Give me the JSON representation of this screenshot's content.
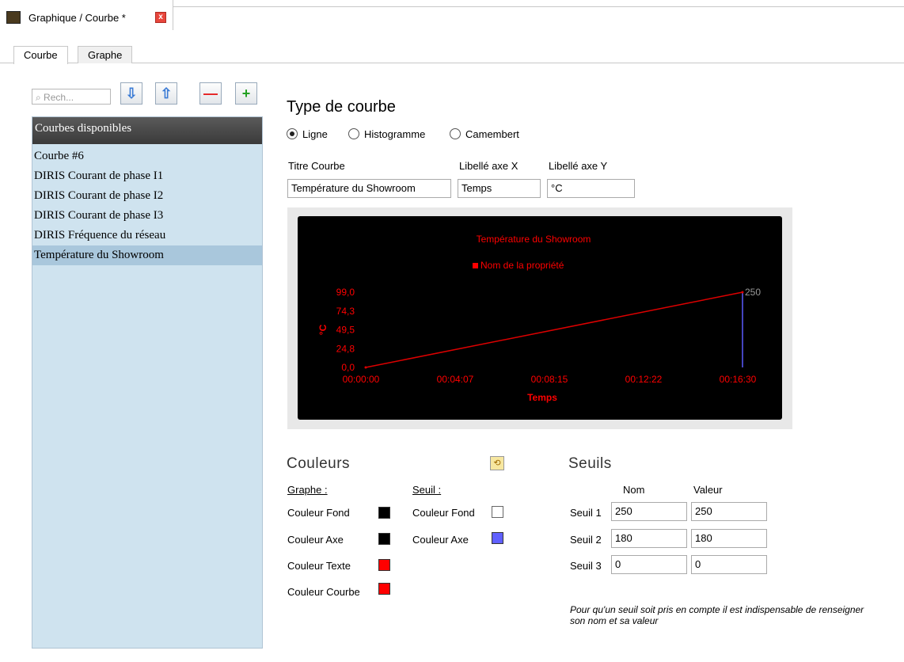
{
  "window": {
    "title": "Graphique / Courbe *",
    "close_glyph": "x"
  },
  "tabs": [
    {
      "label": "Courbe"
    },
    {
      "label": "Graphe"
    }
  ],
  "search": {
    "placeholder": "⌕ Rech..."
  },
  "toolbar": {
    "down_glyph": "⇩",
    "up_glyph": "⇧",
    "remove_glyph": "—",
    "add_glyph": "+"
  },
  "list": {
    "header": "Courbes disponibles",
    "items": [
      "Courbe #6",
      "DIRIS Courant de phase I1",
      "DIRIS Courant de phase I2",
      "DIRIS Courant de phase I3",
      "DIRIS Fréquence du réseau",
      "Température du Showroom"
    ],
    "selected_index": 5
  },
  "type_courbe": {
    "title": "Type de courbe",
    "options": [
      "Ligne",
      "Histogramme",
      "Camembert"
    ],
    "selected": "Ligne"
  },
  "fields": {
    "titre_label": "Titre Courbe",
    "titre_value": "Température du Showroom",
    "x_label": "Libellé axe X",
    "x_value": "Temps",
    "y_label": "Libellé axe Y",
    "y_value": "°C"
  },
  "chart_data": {
    "type": "line",
    "title": "Température du Showroom",
    "legend": "Nom de la propriété",
    "xlabel": "Temps",
    "ylabel": "°C",
    "x_ticks": [
      "00:00:00",
      "00:04:07",
      "00:08:15",
      "00:12:22",
      "00:16:30"
    ],
    "y_ticks": [
      "0,0",
      "24,8",
      "49,5",
      "74,3",
      "99,0"
    ],
    "ylim": [
      0,
      99
    ],
    "xlim_seconds": [
      0,
      990
    ],
    "series": [
      {
        "name": "Nom de la propriété",
        "x": [
          0,
          990
        ],
        "y": [
          0,
          99
        ]
      }
    ],
    "threshold": {
      "label": "250",
      "x": 990
    },
    "colors": {
      "background": "#000000",
      "text": "#ff0000",
      "curve": "#dd0000",
      "threshold": "#5a5aff",
      "threshold_label": "#999999"
    }
  },
  "couleurs": {
    "title": "Couleurs",
    "graphe_label": "Graphe :",
    "seuil_label": "Seuil :",
    "graphe": [
      {
        "label": "Couleur Fond",
        "color": "#000000"
      },
      {
        "label": "Couleur Axe",
        "color": "#000000"
      },
      {
        "label": "Couleur Texte",
        "color": "#ff0000"
      },
      {
        "label": "Couleur Courbe",
        "color": "#ff0000"
      }
    ],
    "seuil": [
      {
        "label": "Couleur Fond",
        "color": "#ffffff"
      },
      {
        "label": "Couleur Axe",
        "color": "#6060ff"
      }
    ]
  },
  "seuils": {
    "title": "Seuils",
    "col_nom": "Nom",
    "col_valeur": "Valeur",
    "rows": [
      {
        "label": "Seuil 1",
        "nom": "250",
        "valeur": "250"
      },
      {
        "label": "Seuil 2",
        "nom": "180",
        "valeur": "180"
      },
      {
        "label": "Seuil 3",
        "nom": "0",
        "valeur": "0"
      }
    ],
    "note": "Pour qu'un seuil soit pris en compte il est indispensable de renseigner son nom et sa valeur"
  }
}
